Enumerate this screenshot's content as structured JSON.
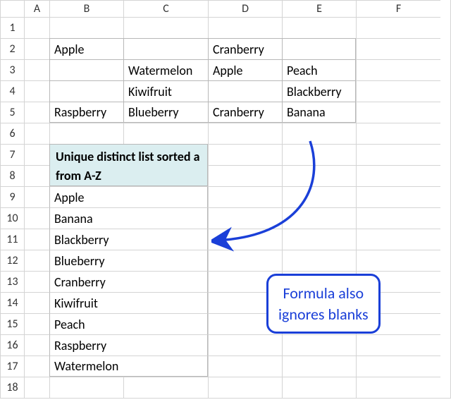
{
  "columns": [
    "A",
    "B",
    "C",
    "D",
    "E",
    "F"
  ],
  "row_count": 18,
  "table": {
    "r2": {
      "B": "Apple",
      "C": "",
      "D": "Cranberry",
      "E": ""
    },
    "r3": {
      "B": "",
      "C": "Watermelon",
      "D": "Apple",
      "E": "Peach"
    },
    "r4": {
      "B": "",
      "C": "Kiwifruit",
      "D": "",
      "E": "Blackberry"
    },
    "r5": {
      "B": "Raspberry",
      "C": "Blueberry",
      "D": "Cranberry",
      "E": "Banana"
    }
  },
  "result": {
    "header": "Unique distinct list sorted a from A-Z",
    "items": [
      "Apple",
      "Banana",
      "Blackberry",
      "Blueberry",
      "Cranberry",
      "Kiwifruit",
      "Peach",
      "Raspberry",
      "Watermelon"
    ]
  },
  "annotation": {
    "line1": "Formula also",
    "line2": "ignores blanks"
  }
}
